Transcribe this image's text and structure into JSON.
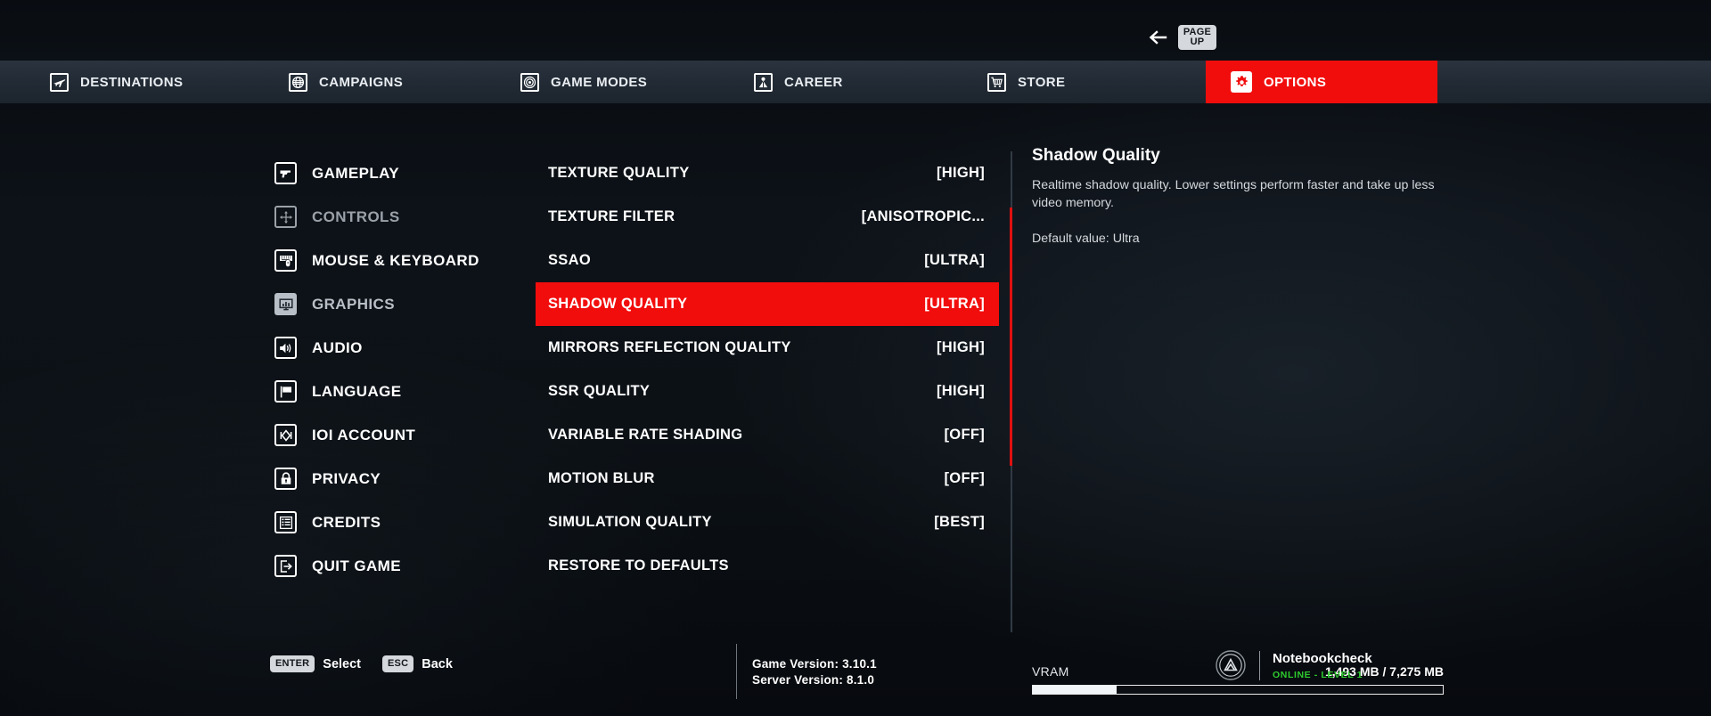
{
  "topbar": {
    "back_icon": "arrow-left-icon",
    "page_up_line1": "PAGE",
    "page_up_line2": "UP"
  },
  "nav": {
    "items": [
      {
        "label": "DESTINATIONS",
        "icon": "airplane-icon",
        "active": false
      },
      {
        "label": "CAMPAIGNS",
        "icon": "globe-icon",
        "active": false
      },
      {
        "label": "GAME MODES",
        "icon": "target-icon",
        "active": false
      },
      {
        "label": "CAREER",
        "icon": "person-icon",
        "active": false
      },
      {
        "label": "STORE",
        "icon": "shopping-cart-icon",
        "active": false
      },
      {
        "label": "OPTIONS",
        "icon": "gear-icon",
        "active": true
      }
    ],
    "active_color": "#f20d0d"
  },
  "sidebar": {
    "items": [
      {
        "label": "GAMEPLAY",
        "icon": "pistol-icon",
        "state": "normal"
      },
      {
        "label": "CONTROLS",
        "icon": "dpad-icon",
        "state": "dim"
      },
      {
        "label": "MOUSE & KEYBOARD",
        "icon": "keyboard-mouse-icon",
        "state": "normal"
      },
      {
        "label": "GRAPHICS",
        "icon": "monitor-icon",
        "state": "selected"
      },
      {
        "label": "AUDIO",
        "icon": "speaker-icon",
        "state": "normal"
      },
      {
        "label": "LANGUAGE",
        "icon": "flag-icon",
        "state": "normal"
      },
      {
        "label": "IOI ACCOUNT",
        "icon": "ioi-diamond-icon",
        "state": "normal"
      },
      {
        "label": "PRIVACY",
        "icon": "lock-icon",
        "state": "normal"
      },
      {
        "label": "CREDITS",
        "icon": "list-document-icon",
        "state": "normal"
      },
      {
        "label": "QUIT GAME",
        "icon": "exit-icon",
        "state": "normal"
      }
    ]
  },
  "settings": {
    "rows": [
      {
        "label": "TEXTURE QUALITY",
        "value": "[HIGH]",
        "selected": false
      },
      {
        "label": "TEXTURE FILTER",
        "value": "[ANISOTROPIC...",
        "selected": false
      },
      {
        "label": "SSAO",
        "value": "[ULTRA]",
        "selected": false
      },
      {
        "label": "SHADOW QUALITY",
        "value": "[ULTRA]",
        "selected": true
      },
      {
        "label": "MIRRORS REFLECTION QUALITY",
        "value": "[HIGH]",
        "selected": false
      },
      {
        "label": "SSR QUALITY",
        "value": "[HIGH]",
        "selected": false
      },
      {
        "label": "VARIABLE RATE SHADING",
        "value": "[OFF]",
        "selected": false
      },
      {
        "label": "MOTION BLUR",
        "value": "[OFF]",
        "selected": false
      },
      {
        "label": "SIMULATION QUALITY",
        "value": "[BEST]",
        "selected": false
      },
      {
        "label": "RESTORE TO DEFAULTS",
        "value": "",
        "selected": false
      }
    ]
  },
  "description": {
    "title": "Shadow Quality",
    "body": "Realtime shadow quality. Lower settings perform faster and take up less video memory.",
    "default_value": "Default value: Ultra"
  },
  "vram": {
    "label": "VRAM",
    "amount": "1,493 MB / 7,275 MB",
    "used_mb": 1493,
    "total_mb": 7275,
    "percent": 20.5
  },
  "footer": {
    "hints": [
      {
        "key": "ENTER",
        "label": "Select"
      },
      {
        "key": "ESC",
        "label": "Back"
      }
    ],
    "game_version": "Game Version: 3.10.1",
    "server_version": "Server Version: 8.1.0",
    "profile_name": "Notebookcheck",
    "profile_status": "ONLINE - LEVEL 1",
    "profile_status_color": "#2ecc2e"
  }
}
